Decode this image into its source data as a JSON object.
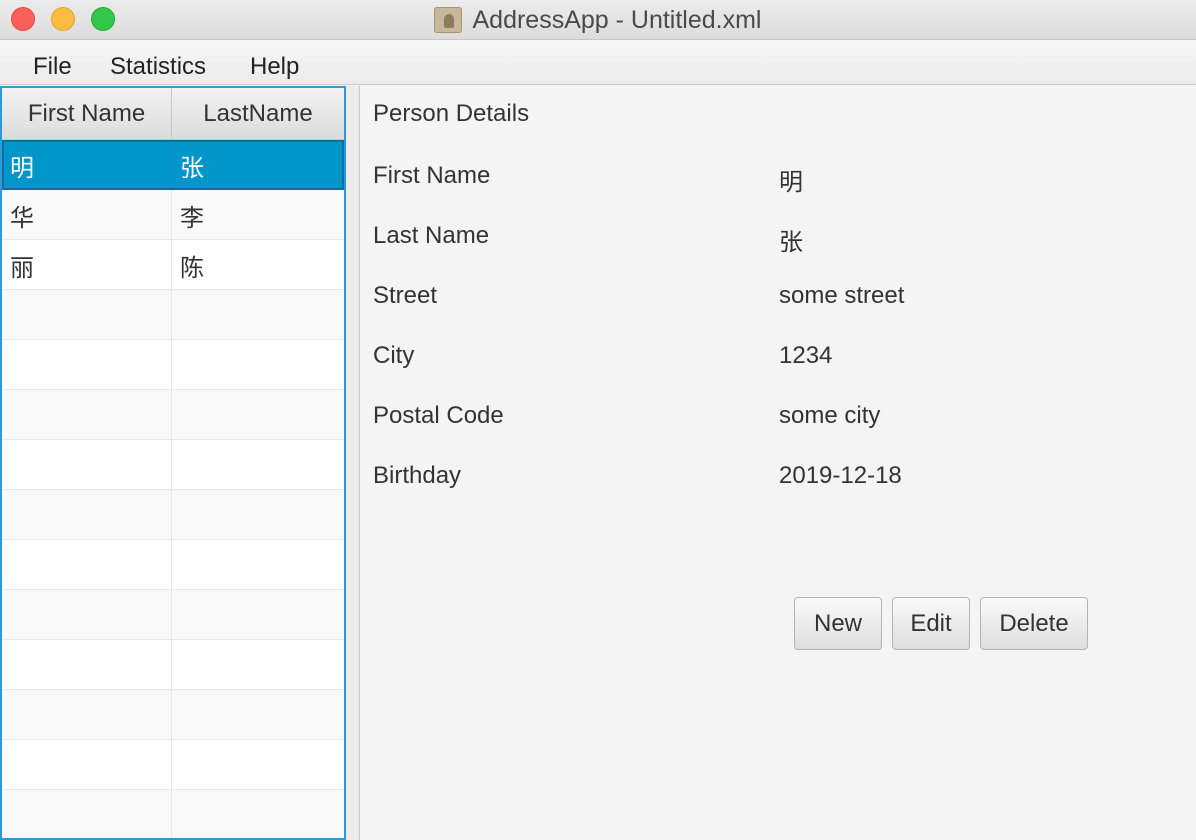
{
  "window": {
    "title": "AddressApp - Untitled.xml"
  },
  "menu": {
    "file": "File",
    "statistics": "Statistics",
    "help": "Help"
  },
  "table": {
    "headers": {
      "first": "First Name",
      "last": "LastName"
    },
    "rows": [
      {
        "first": "明",
        "last": "张"
      },
      {
        "first": "华",
        "last": "李"
      },
      {
        "first": "丽",
        "last": "陈"
      },
      {
        "first": "",
        "last": ""
      },
      {
        "first": "",
        "last": ""
      },
      {
        "first": "",
        "last": ""
      },
      {
        "first": "",
        "last": ""
      },
      {
        "first": "",
        "last": ""
      },
      {
        "first": "",
        "last": ""
      },
      {
        "first": "",
        "last": ""
      },
      {
        "first": "",
        "last": ""
      },
      {
        "first": "",
        "last": ""
      },
      {
        "first": "",
        "last": ""
      },
      {
        "first": "",
        "last": ""
      }
    ],
    "selected_index": 0
  },
  "details": {
    "title": "Person Details",
    "labels": {
      "first_name": "First Name",
      "last_name": "Last Name",
      "street": "Street",
      "city": "City",
      "postal_code": "Postal Code",
      "birthday": "Birthday"
    },
    "values": {
      "first_name": "明",
      "last_name": "张",
      "street": "some street",
      "city": "1234",
      "postal_code": "some city",
      "birthday": "2019-12-18"
    }
  },
  "buttons": {
    "new": "New",
    "edit": "Edit",
    "delete": "Delete"
  },
  "colors": {
    "selection": "#0096c9",
    "focus_border": "#2c9ad6"
  },
  "icons": {
    "app": "address-book-icon"
  }
}
